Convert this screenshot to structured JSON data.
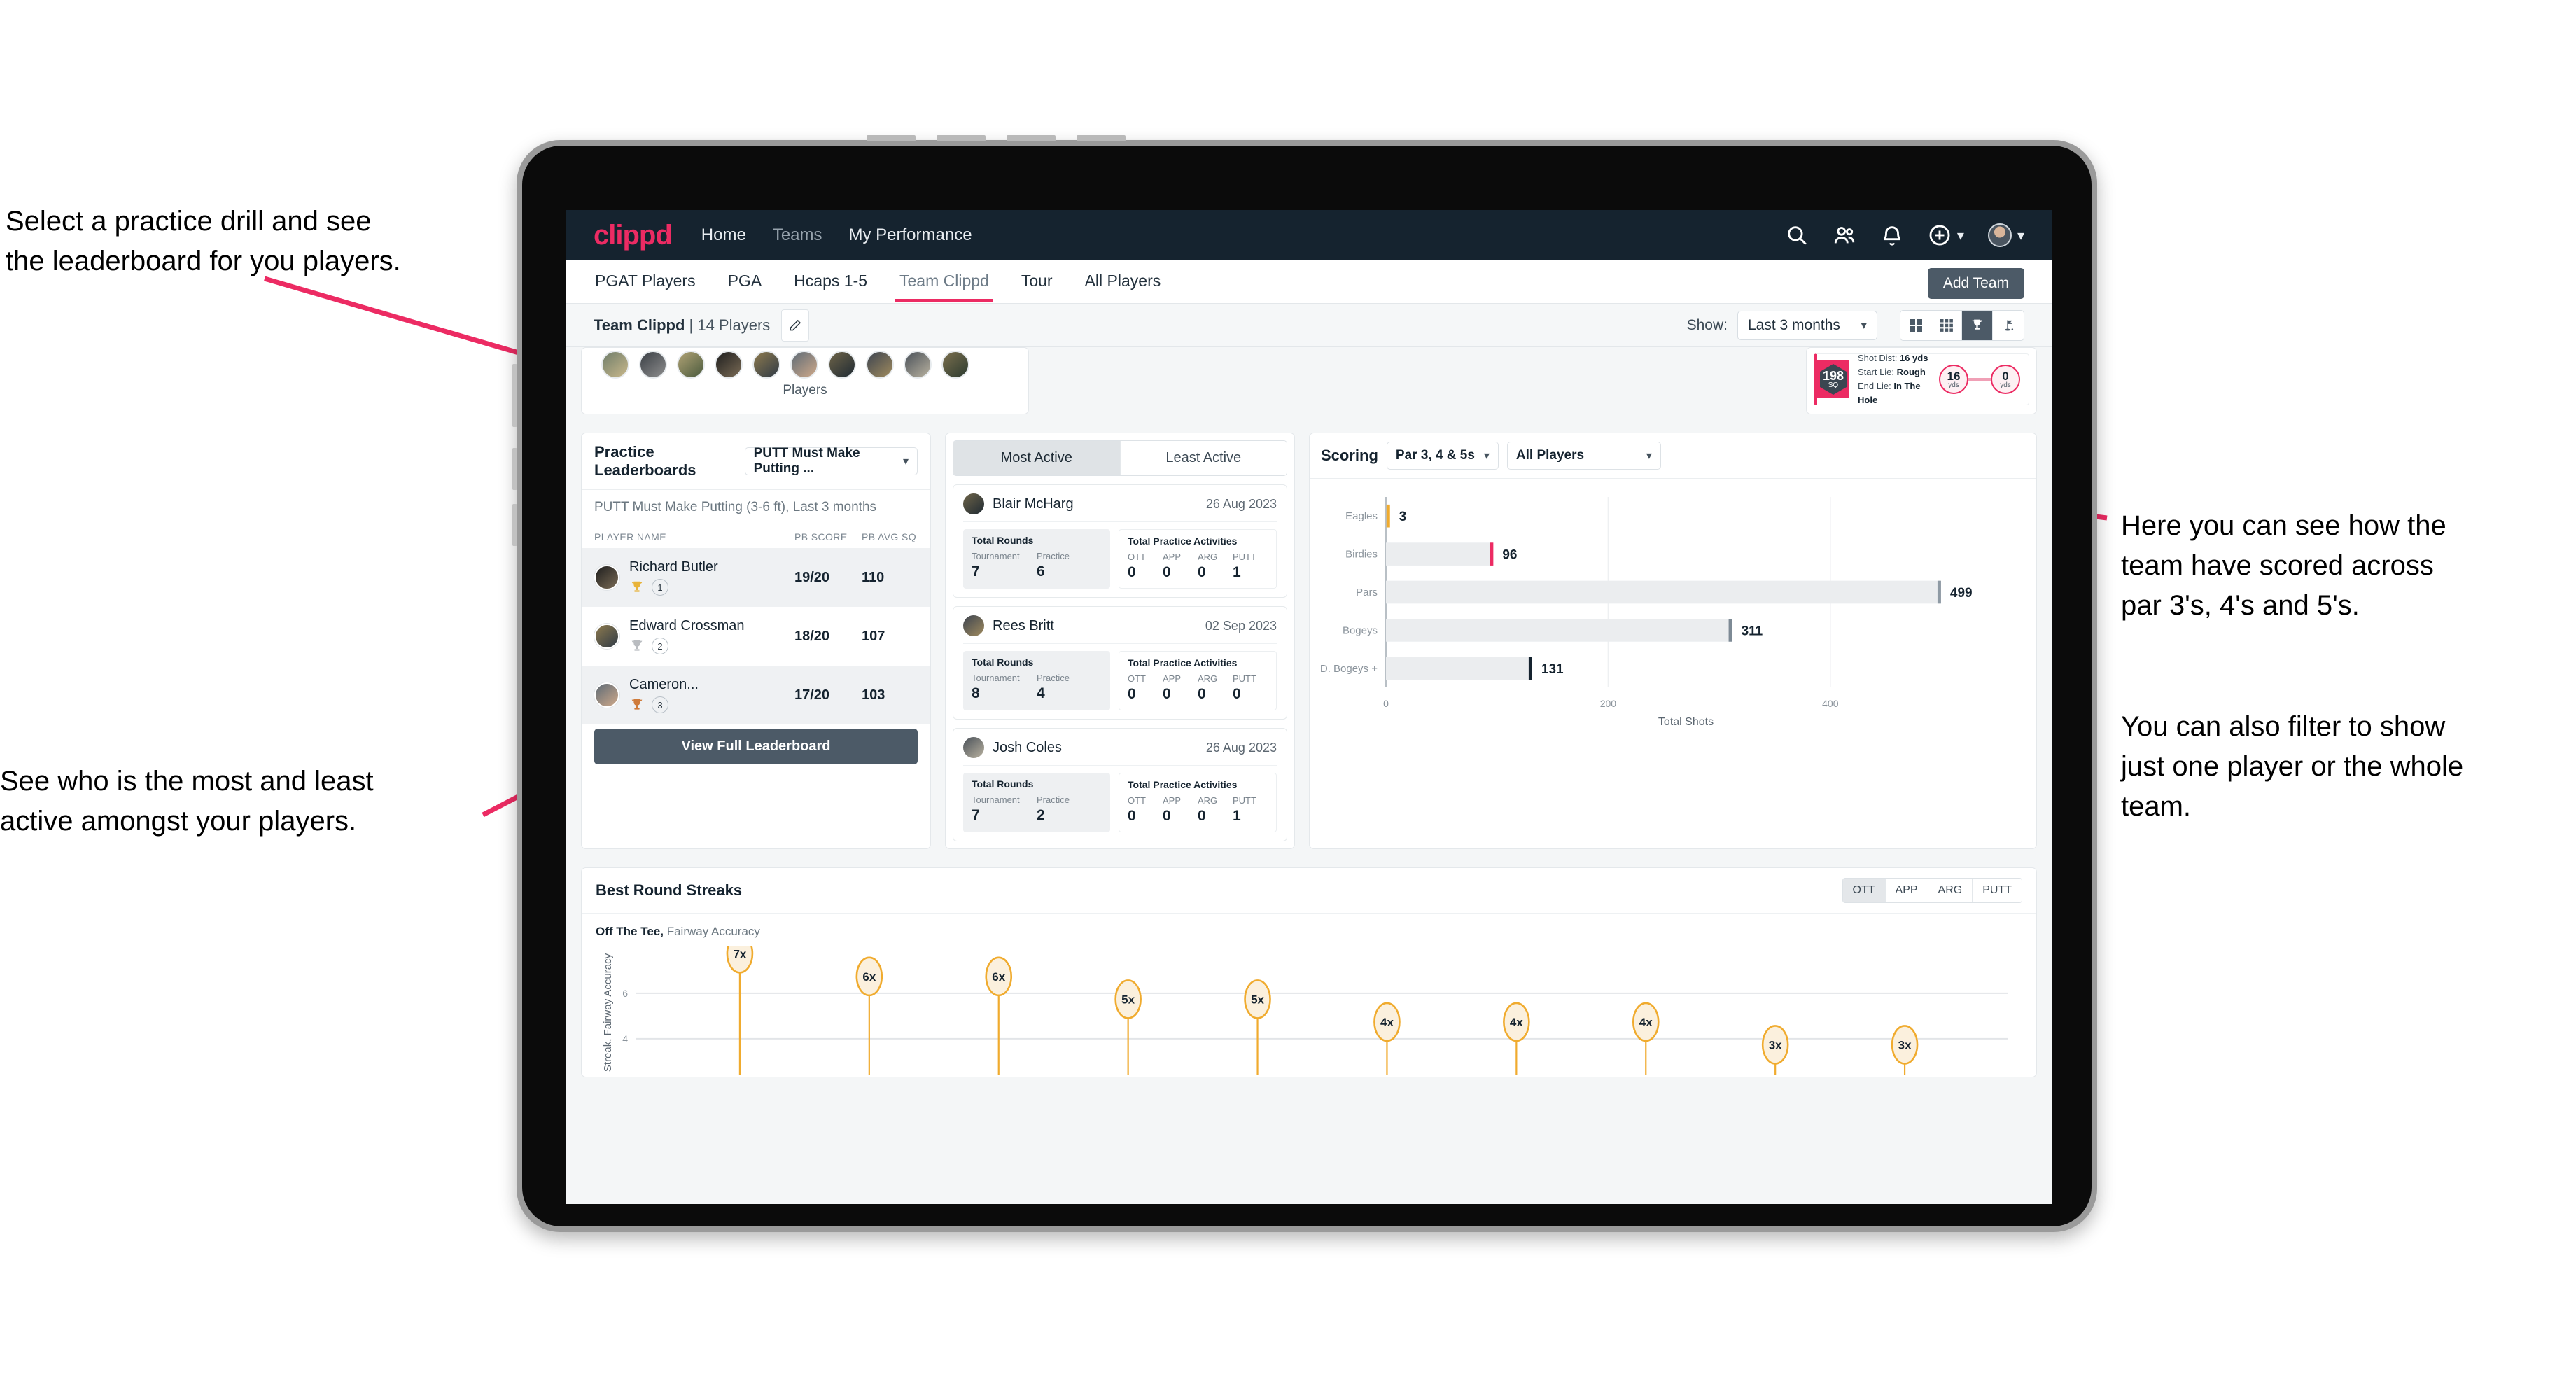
{
  "annotations": [
    {
      "id": "ann-practice-drill",
      "text": "Select a practice drill and see\nthe leaderboard for you players."
    },
    {
      "id": "ann-most-least-active",
      "text": "See who is the most and least\nactive amongst your players."
    },
    {
      "id": "ann-scoring",
      "text": "Here you can see how the\nteam have scored across\npar 3's, 4's and 5's."
    },
    {
      "id": "ann-filter",
      "text": "You can also filter to show\njust one player or the whole\nteam."
    }
  ],
  "navbar": {
    "logo": "clippd",
    "links": [
      {
        "label": "Home",
        "active": true
      },
      {
        "label": "Teams",
        "active": false
      },
      {
        "label": "My Performance",
        "active": true
      }
    ],
    "icons": [
      "search-icon",
      "people-icon",
      "bell-icon",
      "plus-circle-icon",
      "avatar"
    ]
  },
  "tabs": [
    {
      "label": "PGAT Players",
      "active": false
    },
    {
      "label": "PGA",
      "active": false
    },
    {
      "label": "Hcaps 1-5",
      "active": false
    },
    {
      "label": "Team Clippd",
      "active": true
    },
    {
      "label": "Tour",
      "active": false
    },
    {
      "label": "All Players",
      "active": false
    }
  ],
  "add_team_label": "Add Team",
  "subheader": {
    "team_name": "Team Clippd",
    "team_meta": "| 14 Players",
    "show_label": "Show:",
    "range_value": "Last 3 months",
    "view_toggles": [
      "grid-large-icon",
      "grid-small-icon",
      "trophy-icon",
      "flag-icon"
    ],
    "active_view": "trophy-icon"
  },
  "players_card": {
    "caption": "Players",
    "count": 10
  },
  "shot_card": {
    "sq_value": "198",
    "sq_label": "SQ",
    "lines": [
      {
        "key": "Shot Dist:",
        "value": "16 yds"
      },
      {
        "key": "Start Lie:",
        "value": "Rough"
      },
      {
        "key": "End Lie:",
        "value": "In The Hole"
      }
    ],
    "start_dist": "16",
    "start_unit": "yds",
    "end_dist": "0",
    "end_unit": "yds"
  },
  "leaderboard": {
    "title": "Practice Leaderboards",
    "drill_selected": "PUTT Must Make Putting ...",
    "subtitle_bold": "PUTT Must Make Putting (3-6 ft),",
    "subtitle_light": " Last 3 months",
    "columns": [
      "PLAYER NAME",
      "PB SCORE",
      "PB AVG SQ"
    ],
    "rows": [
      {
        "name": "Richard Butler",
        "rank": "1",
        "trophy": "gold",
        "pb_score": "19/20",
        "pb_avg_sq": "110"
      },
      {
        "name": "Edward Crossman",
        "rank": "2",
        "trophy": "silver",
        "pb_score": "18/20",
        "pb_avg_sq": "107"
      },
      {
        "name": "Cameron...",
        "rank": "3",
        "trophy": "bronze",
        "pb_score": "17/20",
        "pb_avg_sq": "103"
      }
    ],
    "button_label": "View Full Leaderboard"
  },
  "activity": {
    "tabs": [
      {
        "label": "Most Active",
        "active": true
      },
      {
        "label": "Least Active",
        "active": false
      }
    ],
    "rounds_title": "Total Rounds",
    "rounds_keys": [
      "Tournament",
      "Practice"
    ],
    "practice_title": "Total Practice Activities",
    "practice_keys": [
      "OTT",
      "APP",
      "ARG",
      "PUTT"
    ],
    "players": [
      {
        "name": "Blair McHarg",
        "date": "26 Aug 2023",
        "rounds": [
          "7",
          "6"
        ],
        "practice": [
          "0",
          "0",
          "0",
          "1"
        ]
      },
      {
        "name": "Rees Britt",
        "date": "02 Sep 2023",
        "rounds": [
          "8",
          "4"
        ],
        "practice": [
          "0",
          "0",
          "0",
          "0"
        ]
      },
      {
        "name": "Josh Coles",
        "date": "26 Aug 2023",
        "rounds": [
          "7",
          "2"
        ],
        "practice": [
          "0",
          "0",
          "0",
          "1"
        ]
      }
    ]
  },
  "scoring": {
    "title": "Scoring",
    "par_filter": "Par 3, 4 & 5s",
    "player_filter": "All Players"
  },
  "streaks": {
    "title": "Best Round Streaks",
    "tabs": [
      {
        "label": "OTT",
        "active": true
      },
      {
        "label": "APP",
        "active": false
      },
      {
        "label": "ARG",
        "active": false
      },
      {
        "label": "PUTT",
        "active": false
      }
    ],
    "subtitle_bold": "Off The Tee,",
    "subtitle_light": " Fairway Accuracy"
  },
  "chart_data": [
    {
      "type": "bar",
      "orientation": "horizontal",
      "title": "Scoring",
      "categories": [
        "Eagles",
        "Birdies",
        "Pars",
        "Bogeys",
        "D. Bogeys +"
      ],
      "values": [
        3,
        96,
        499,
        311,
        131
      ],
      "bar_colors": [
        "#f0ab2e",
        "#ec2b63",
        "#8e9aa4",
        "#7d8a95",
        "#15232f"
      ],
      "xlabel": "Total Shots",
      "ylabel": "",
      "xticks": [
        0,
        200,
        400
      ],
      "xlim": [
        0,
        540
      ],
      "grid": true,
      "legend": "none"
    },
    {
      "type": "scatter",
      "title": "Best Round Streaks",
      "subtitle": "Off The Tee, Fairway Accuracy",
      "ylabel": "Streak, Fairway Accuracy",
      "xlabel": "",
      "yticks": [
        4,
        6
      ],
      "ylim": [
        2.4,
        7.9
      ],
      "values": [
        7,
        6,
        6,
        5,
        5,
        4,
        4,
        4,
        3,
        3
      ],
      "point_labels": [
        "7x",
        "6x",
        "6x",
        "5x",
        "5x",
        "4x",
        "4x",
        "4x",
        "3x",
        "3x"
      ],
      "marker_color": "#f0ab2e",
      "marker_fill": "#fbf0dd",
      "grid": true,
      "legend": "none"
    }
  ],
  "colors": {
    "brand_pink": "#ec2b63",
    "navbar_dark": "#15232f",
    "button_slate": "#4c5a67",
    "accent_gold": "#f0ab2e",
    "annotation_arrow": "#ec2b63"
  }
}
